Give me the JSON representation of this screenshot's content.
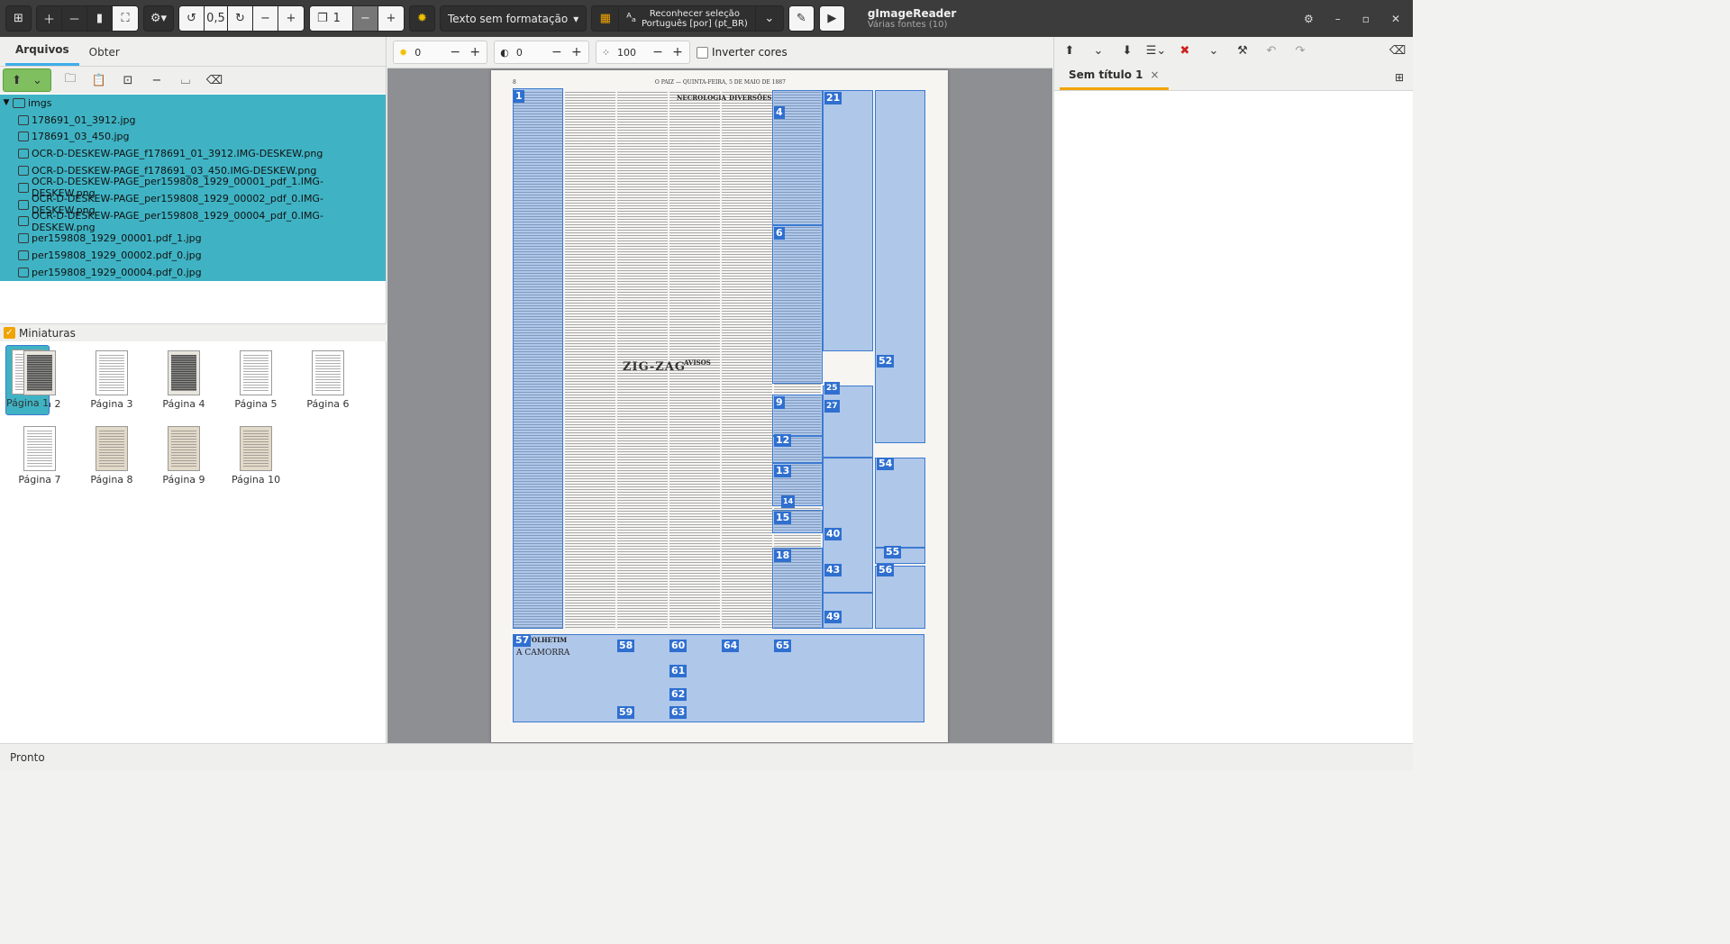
{
  "header": {
    "rotation": "0,5",
    "page": "1",
    "output_mode": "Texto sem formatação",
    "recognize_label": "Reconhecer seleção",
    "recognize_lang": "Português [por] (pt_BR)",
    "app_title": "gImageReader",
    "app_subtitle": "Várias fontes (10)"
  },
  "left": {
    "tabs": [
      "Arquivos",
      "Obter"
    ],
    "root_folder": "imgs",
    "files": [
      "178691_01_3912.jpg",
      "178691_03_450.jpg",
      "OCR-D-DESKEW-PAGE_f178691_01_3912.IMG-DESKEW.png",
      "OCR-D-DESKEW-PAGE_f178691_03_450.IMG-DESKEW.png",
      "OCR-D-DESKEW-PAGE_per159808_1929_00001_pdf_1.IMG-DESKEW.png",
      "OCR-D-DESKEW-PAGE_per159808_1929_00002_pdf_0.IMG-DESKEW.png",
      "OCR-D-DESKEW-PAGE_per159808_1929_00004_pdf_0.IMG-DESKEW.png",
      "per159808_1929_00001.pdf_1.jpg",
      "per159808_1929_00002.pdf_0.jpg",
      "per159808_1929_00004.pdf_0.jpg"
    ],
    "thumbnails_label": "Miniaturas",
    "thumbnails": [
      "Página 1",
      "Página 2",
      "Página 3",
      "Página 4",
      "Página 5",
      "Página 6",
      "Página 7",
      "Página 8",
      "Página 9",
      "Página 10"
    ]
  },
  "center": {
    "brightness": "0",
    "contrast": "0",
    "resolution": "100",
    "invert_label": "Inverter cores",
    "page_header": {
      "left": "8",
      "middle": "O PAIZ — QUINTA-FEIRA, 5 DE MAIO DE 1887"
    },
    "column_titles": [
      "NECROLOGIA",
      "DIVERSÕES",
      "FOLHETIM",
      "A CAMORRA",
      "AVISOS"
    ],
    "zigzag": "ZIG-ZAG",
    "regions": [
      "1",
      "4",
      "6",
      "9",
      "12",
      "13",
      "14",
      "15",
      "18",
      "21",
      "25",
      "27",
      "40",
      "43",
      "49",
      "52",
      "54",
      "55",
      "56",
      "57",
      "58",
      "59",
      "60",
      "61",
      "62",
      "63",
      "64",
      "65"
    ]
  },
  "right": {
    "doc_tab": "Sem título 1"
  },
  "status": "Pronto"
}
